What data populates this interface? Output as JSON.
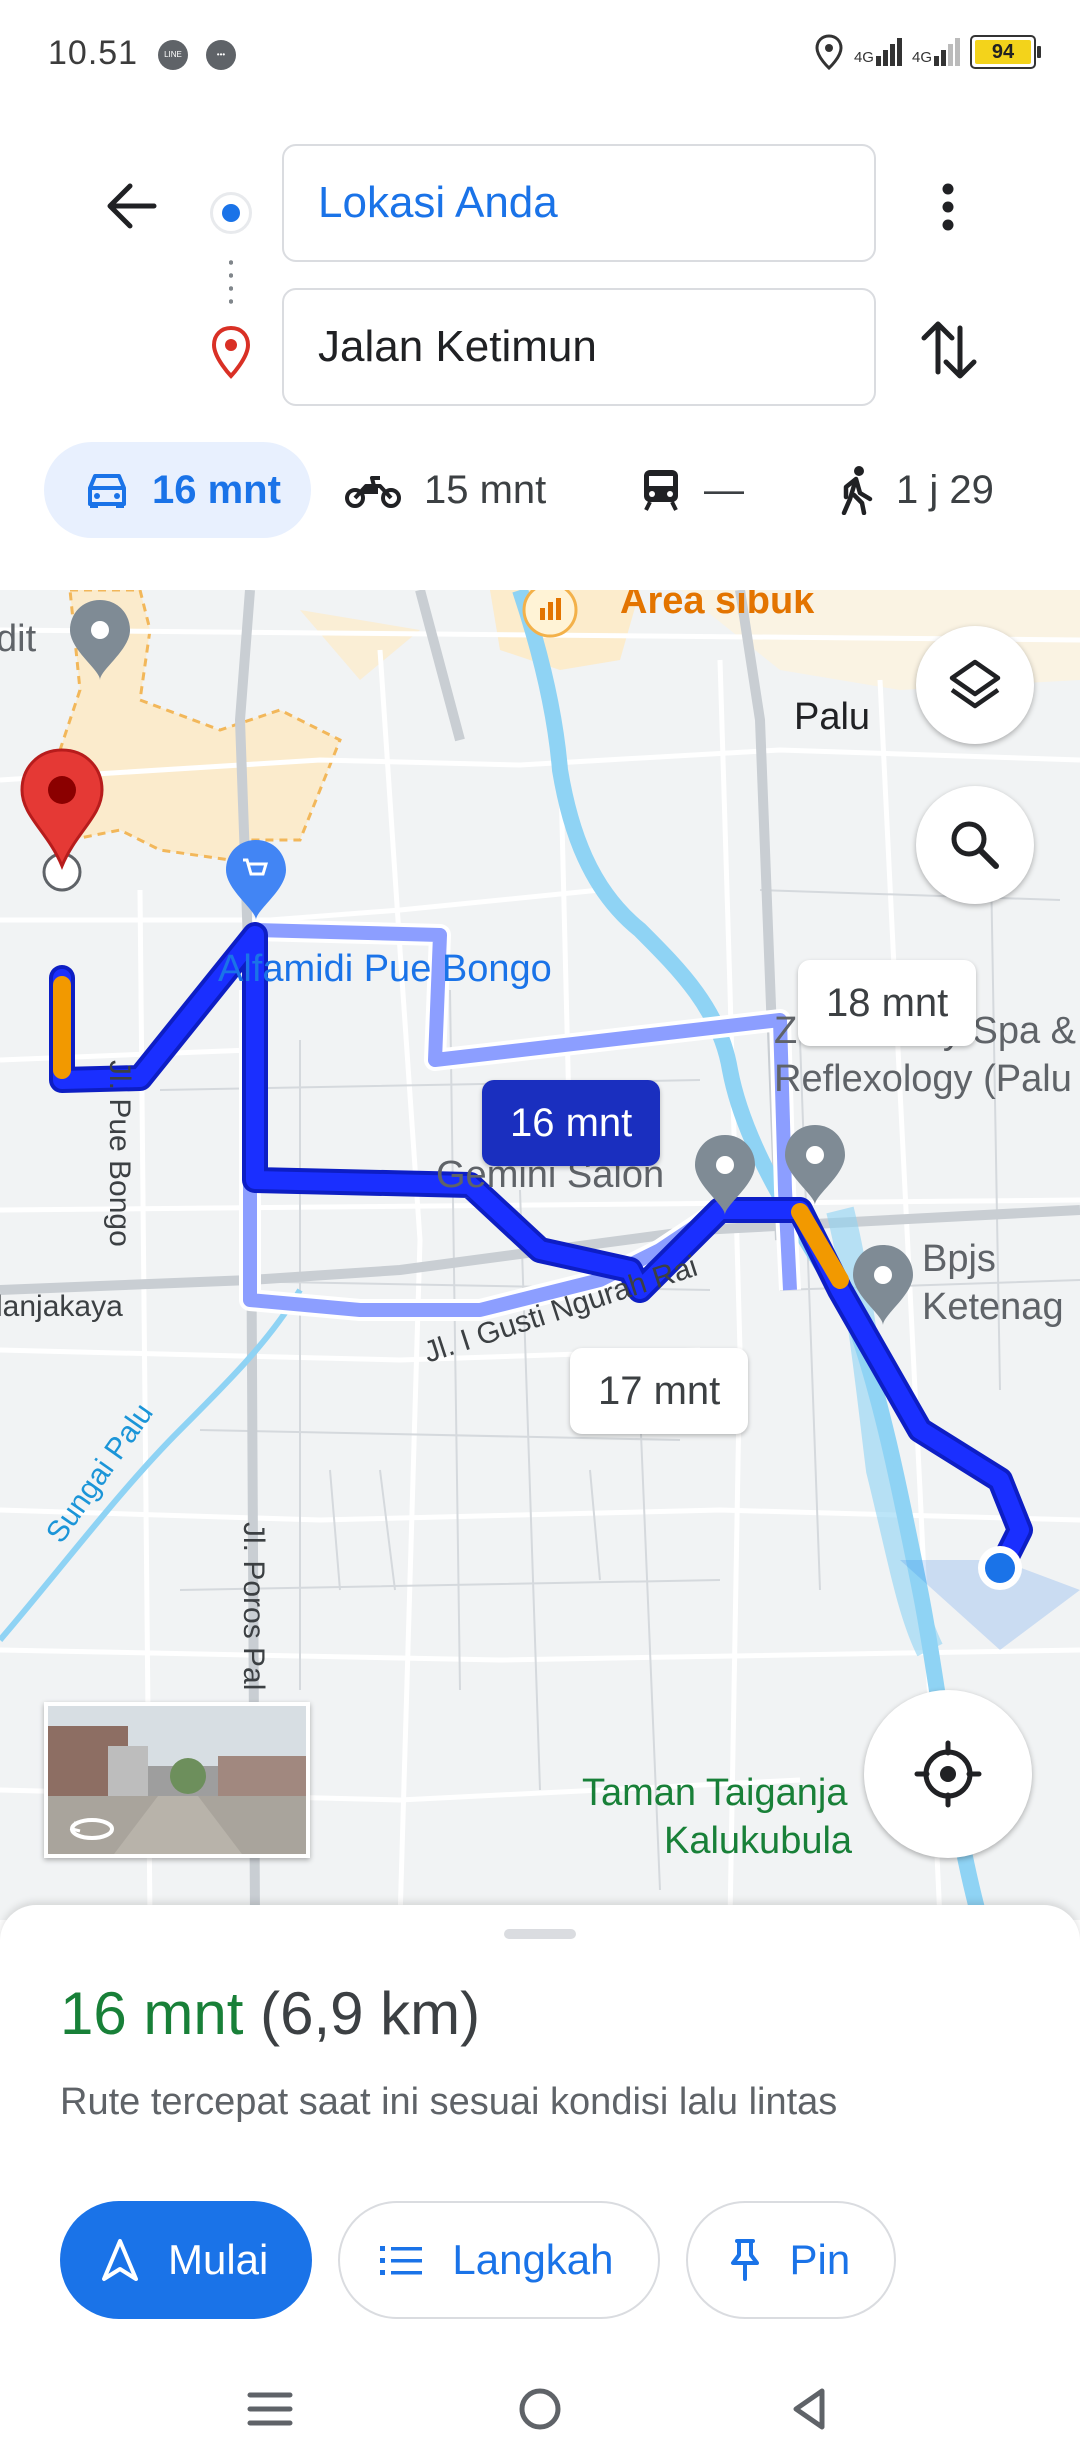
{
  "status_bar": {
    "time": "10.51",
    "signal_1": "4G",
    "signal_2": "4G",
    "battery": "94"
  },
  "directions": {
    "origin": "Lokasi Anda",
    "destination": "Jalan Ketimun",
    "modes": [
      {
        "icon": "car-icon",
        "label": "16 mnt",
        "active": true
      },
      {
        "icon": "motorcycle-icon",
        "label": "15 mnt",
        "active": false
      },
      {
        "icon": "transit-icon",
        "label": "—",
        "active": false
      },
      {
        "icon": "walk-icon",
        "label": "1 j 29",
        "active": false
      }
    ]
  },
  "map": {
    "labels": {
      "busy_area": "Area sibuk",
      "palu": "Palu",
      "alfamidi": "Alfamidi Pue Bongo",
      "zen_spa_1": "Zen Family Spa &",
      "zen_spa_2": "Reflexology (Palu",
      "gemini": "Gemini Salon",
      "bpjs_1": "Bpjs",
      "bpjs_2": "Ketenag",
      "taman_1": "Taman Taiganja",
      "taman_2": "Kalukubula",
      "dit": "dit",
      "road_pue_bongo": "Jl. Pue Bongo",
      "road_gusti": "Jl. I Gusti Ngurah Rai",
      "road_anjakaya": "lanjakaya",
      "river": "Sungai Palu",
      "road_poros": "Jl. Poros Pal"
    },
    "route_bubbles": {
      "best": "16 mnt",
      "alt_1": "18 mnt",
      "alt_2": "17 mnt"
    }
  },
  "route_summary": {
    "duration": "16 mnt",
    "distance": "(6,9 km)",
    "note": "Rute tercepat saat ini sesuai kondisi lalu lintas"
  },
  "actions": {
    "start": "Mulai",
    "steps": "Langkah",
    "pin": "Pin"
  },
  "colors": {
    "accent": "#1a73e8",
    "route_primary": "#1a2fff",
    "route_alt": "#8c9eff",
    "traffic": "#f29900",
    "duration_green": "#188038",
    "destination_pin": "#d93025"
  }
}
